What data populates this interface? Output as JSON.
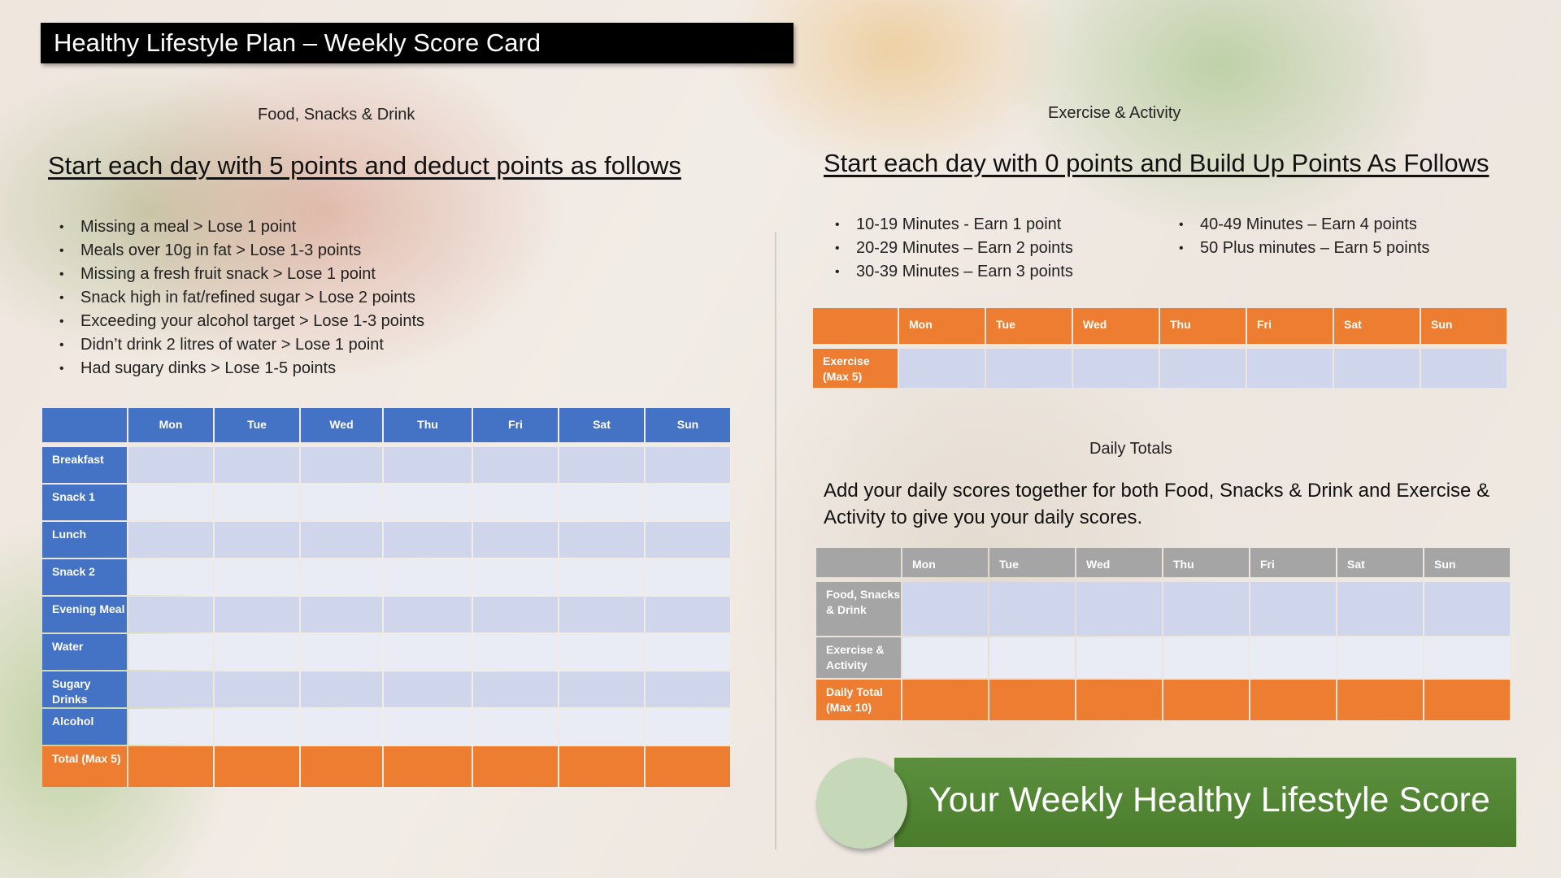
{
  "title": "Healthy Lifestyle Plan – Weekly Score Card",
  "days": [
    "Mon",
    "Tue",
    "Wed",
    "Thu",
    "Fri",
    "Sat",
    "Sun"
  ],
  "food": {
    "section_label": "Food, Snacks & Drink",
    "heading": "Start each day with 5 points and deduct points as follows",
    "rules": [
      "Missing a meal > Lose 1 point",
      "Meals over 10g in fat > Lose 1-3 points",
      "Missing a fresh fruit snack > Lose 1 point",
      "Snack high in fat/refined sugar > Lose 2 points",
      "Exceeding your alcohol target > Lose 1-3 points",
      "Didn’t drink 2 litres of water > Lose 1 point",
      "Had sugary dinks > Lose 1-5 points"
    ],
    "rows": [
      "Breakfast",
      "Snack 1",
      "Lunch",
      "Snack 2",
      "Evening Meal",
      "Water",
      "Sugary Drinks",
      "Alcohol"
    ],
    "total_row": "Total (Max 5)",
    "header_color": "#4472c4"
  },
  "exercise": {
    "section_label": "Exercise & Activity",
    "heading": "Start each day with 0 points and Build Up Points As Follows",
    "rules_col1": [
      "10-19 Minutes - Earn 1 point",
      "20-29 Minutes – Earn 2 points",
      "30-39 Minutes – Earn 3 points"
    ],
    "rules_col2": [
      "40-49 Minutes – Earn 4 points",
      "50 Plus minutes – Earn 5 points"
    ],
    "row": "Exercise (Max 5)",
    "header_color": "#ed7d31"
  },
  "daily_totals": {
    "section_label": "Daily Totals",
    "description": "Add your daily scores together for both Food, Snacks & Drink and Exercise & Activity to give you your daily scores.",
    "rows": [
      "Food, Snacks & Drink",
      "Exercise & Activity"
    ],
    "total_row": "Daily Total (Max 10)",
    "header_color": "#a5a5a5"
  },
  "weekly_score": {
    "label": "Your Weekly Healthy Lifestyle Score",
    "color": "#548235"
  }
}
